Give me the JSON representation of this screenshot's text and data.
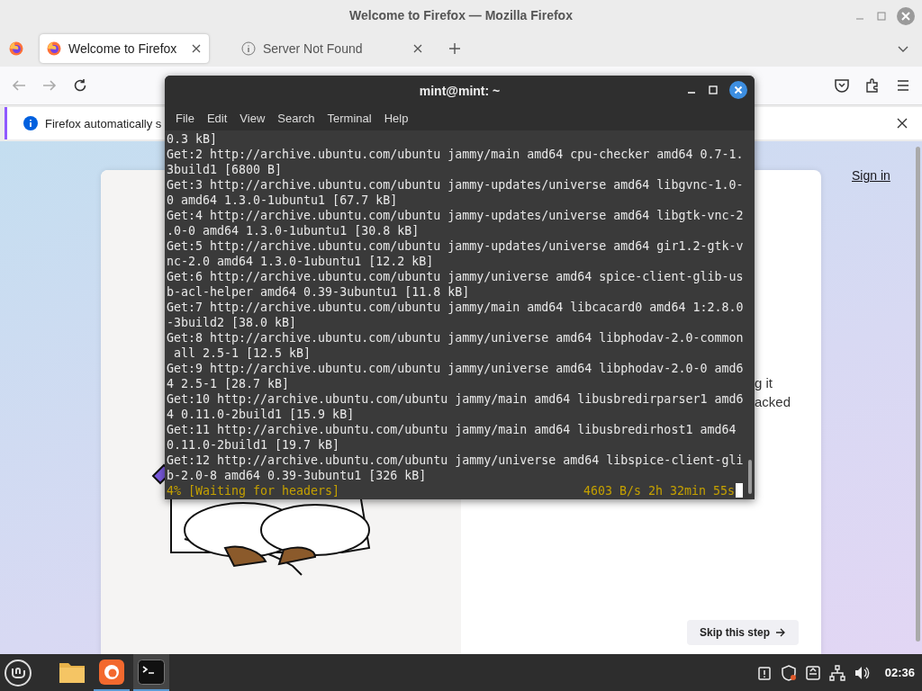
{
  "firefox": {
    "title": "Welcome to Firefox — Mozilla Firefox",
    "tabs": [
      {
        "label": "Welcome to Firefox",
        "kind": "firefox",
        "selected": true
      },
      {
        "label": "Server Not Found",
        "kind": "info",
        "selected": false
      }
    ],
    "notification": {
      "text": "Firefox automatically s"
    },
    "page": {
      "sign_in": "Sign in",
      "partial_text": [
        "g it",
        "acked"
      ],
      "skip_button": "Skip this step"
    }
  },
  "terminal": {
    "title": "mint@mint: ~",
    "menu": [
      "File",
      "Edit",
      "View",
      "Search",
      "Terminal",
      "Help"
    ],
    "lines": [
      "0.3 kB]",
      "Get:2 http://archive.ubuntu.com/ubuntu jammy/main amd64 cpu-checker amd64 0.7-1.",
      "3build1 [6800 B]",
      "Get:3 http://archive.ubuntu.com/ubuntu jammy-updates/universe amd64 libgvnc-1.0-",
      "0 amd64 1.3.0-1ubuntu1 [67.7 kB]",
      "Get:4 http://archive.ubuntu.com/ubuntu jammy-updates/universe amd64 libgtk-vnc-2",
      ".0-0 amd64 1.3.0-1ubuntu1 [30.8 kB]",
      "Get:5 http://archive.ubuntu.com/ubuntu jammy-updates/universe amd64 gir1.2-gtk-v",
      "nc-2.0 amd64 1.3.0-1ubuntu1 [12.2 kB]",
      "Get:6 http://archive.ubuntu.com/ubuntu jammy/universe amd64 spice-client-glib-us",
      "b-acl-helper amd64 0.39-3ubuntu1 [11.8 kB]",
      "Get:7 http://archive.ubuntu.com/ubuntu jammy/main amd64 libcacard0 amd64 1:2.8.0",
      "-3build2 [38.0 kB]",
      "Get:8 http://archive.ubuntu.com/ubuntu jammy/universe amd64 libphodav-2.0-common",
      " all 2.5-1 [12.5 kB]",
      "Get:9 http://archive.ubuntu.com/ubuntu jammy/universe amd64 libphodav-2.0-0 amd6",
      "4 2.5-1 [28.7 kB]",
      "Get:10 http://archive.ubuntu.com/ubuntu jammy/main amd64 libusbredirparser1 amd6",
      "4 0.11.0-2build1 [15.9 kB]",
      "Get:11 http://archive.ubuntu.com/ubuntu jammy/main amd64 libusbredirhost1 amd64",
      "0.11.0-2build1 [19.7 kB]",
      "Get:12 http://archive.ubuntu.com/ubuntu jammy/universe amd64 libspice-client-gli",
      "b-2.0-8 amd64 0.39-3ubuntu1 [326 kB]"
    ],
    "status_left": "4% [Waiting for headers]",
    "status_right": "4603 B/s 2h 32min 55s"
  },
  "taskbar": {
    "apps": [
      {
        "kind": "files",
        "running": false,
        "selected": false
      },
      {
        "kind": "firefox",
        "running": true,
        "selected": false
      },
      {
        "kind": "terminal",
        "running": true,
        "selected": true
      }
    ],
    "clock": "02:36"
  }
}
